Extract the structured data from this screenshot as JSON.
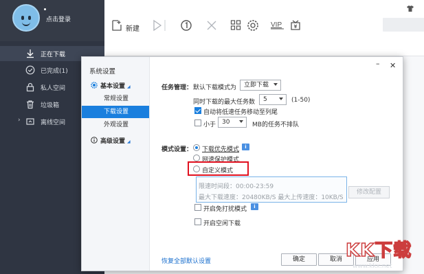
{
  "sidebar": {
    "login_text": "点击登录",
    "items": [
      {
        "label": "正在下载",
        "icon": "download-arrow-icon",
        "active": true
      },
      {
        "label": "已完成(1)",
        "icon": "check-circle-icon",
        "active": false
      },
      {
        "label": "私人空间",
        "icon": "lock-icon",
        "active": false
      },
      {
        "label": "垃圾箱",
        "icon": "trash-icon",
        "active": false
      },
      {
        "label": "离线空间",
        "icon": "cloud-icon",
        "active": false
      }
    ]
  },
  "toolbar": {
    "new_label": "新建",
    "icons": [
      "new-file-icon",
      "play-icon",
      "speed-limit-icon",
      "delete-icon",
      "grid-icon",
      "settings-icon",
      "vip-icon",
      "wallet-icon"
    ],
    "vip_text": "VIP"
  },
  "dialog": {
    "title": "系统设置",
    "groups": [
      {
        "label": "基本设置",
        "icon": "gear-icon",
        "expanded": true,
        "subs": [
          {
            "label": "常规设置",
            "active": false
          },
          {
            "label": "下载设置",
            "active": true
          },
          {
            "label": "外观设置",
            "active": false
          }
        ]
      },
      {
        "label": "高级设置",
        "icon": "info-icon",
        "expanded": true,
        "subs": []
      }
    ],
    "task_mgmt": {
      "label": "任务管理：",
      "default_mode_label": "默认下载模式为",
      "default_mode_value": "立即下载",
      "max_tasks_label": "同时下载的最大任务数",
      "max_tasks_value": "5",
      "max_tasks_range": "(1-50)",
      "auto_move_label": "自动将低速任务移动至列尾",
      "auto_move_checked": true,
      "less_than_label": "小于",
      "less_than_value": "30",
      "less_than_suffix": "MB的任务不排队",
      "less_than_checked": false
    },
    "mode": {
      "label": "模式设置：",
      "options": [
        {
          "label": "下载优先模式",
          "checked": true,
          "info": true
        },
        {
          "label": "网速保护模式",
          "checked": false,
          "info": false
        },
        {
          "label": "自定义模式",
          "checked": false,
          "info": false
        }
      ],
      "speed_limit_time": "限速时间段：00:00-23:59",
      "speed_limit_detail": "最大下载速度：20480KB/S  最大上传速度：10KB/S",
      "config_button": "修改配置",
      "no_disturb_label": "开启免打扰模式",
      "idle_download_label": "开启空闲下载"
    },
    "restore_link": "恢复全部默认设置",
    "buttons": {
      "ok": "确定",
      "cancel": "取消",
      "apply": "应用"
    }
  },
  "watermark": {
    "text": "KK下载",
    "url": "www.kkx.net"
  },
  "colors": {
    "accent": "#1a7fde",
    "sidebar_bg": "#2f3542",
    "highlight": "#e0101e"
  }
}
